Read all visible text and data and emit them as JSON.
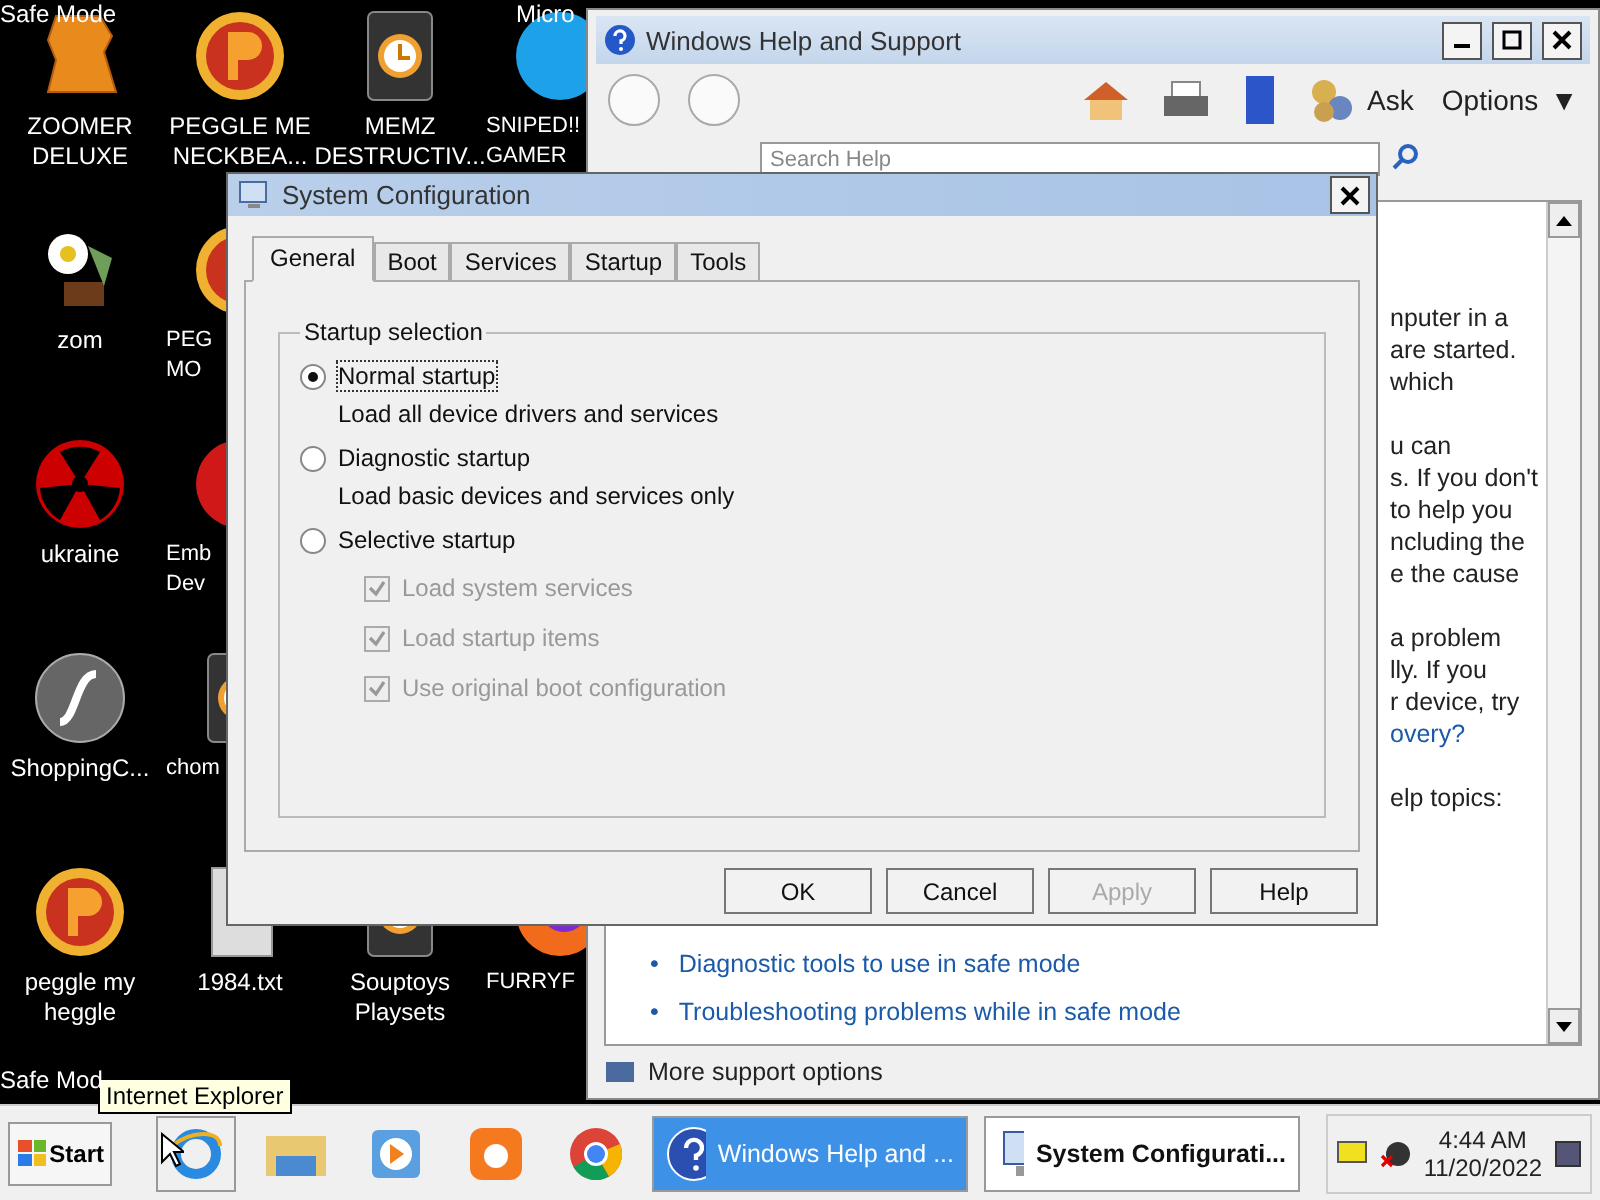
{
  "desktop": {
    "corner_texts": [
      "Safe Mode",
      "Micro",
      "Safe Mod"
    ],
    "columns": [
      [
        {
          "lines": [
            "ZOOMER",
            "DELUXE"
          ],
          "kind": "block",
          "cut": false
        },
        {
          "lines": [
            "zom"
          ],
          "kind": "flower",
          "cut": false
        },
        {
          "lines": [
            "ukraine"
          ],
          "kind": "radiation",
          "cut": false
        },
        {
          "lines": [
            "ShoppingC..."
          ],
          "kind": "flash",
          "cut": false
        },
        {
          "lines": [
            "peggle my",
            "heggle"
          ],
          "kind": "badge",
          "cut": false
        }
      ],
      [
        {
          "lines": [
            "PEGGLE ME",
            "NECKBEA..."
          ],
          "kind": "badge",
          "cut": false
        },
        {
          "lines": [
            "PEG",
            "MO"
          ],
          "kind": "badge",
          "cut": true
        },
        {
          "lines": [
            "Emb",
            "Dev"
          ],
          "kind": "red",
          "cut": true
        },
        {
          "lines": [
            "chom"
          ],
          "kind": "clock",
          "cut": true
        },
        {
          "lines": [
            "1984.txt"
          ],
          "kind": "doc",
          "cut": false
        }
      ],
      [
        {
          "lines": [
            "MEMZ",
            "DESTRUCTIV..."
          ],
          "kind": "clock",
          "cut": false
        },
        {
          "lines": [
            "Souptoys",
            "Playsets"
          ],
          "kind": "clock",
          "cut": false
        }
      ],
      [
        {
          "lines": [
            "SNIPED!!",
            "GAMER"
          ],
          "kind": "chat",
          "cut": true
        },
        {
          "lines": [
            "FURRYF"
          ],
          "kind": "fox",
          "cut": true
        }
      ]
    ]
  },
  "help_window": {
    "title": "Windows Help and Support",
    "toolbar": {
      "ask": "Ask",
      "options": "Options",
      "options_caret": "▼"
    },
    "search": {
      "placeholder": "Search Help"
    },
    "paragraphs": [
      [
        "nputer in a",
        "are started.",
        "which"
      ],
      [
        "u can",
        "s. If you don't",
        "to help you",
        "ncluding the",
        "e the cause"
      ],
      [
        "a problem",
        "lly. If you",
        "r device, try",
        "overy?"
      ],
      [
        "elp topics:"
      ]
    ],
    "links": [
      {
        "bullet": "•",
        "text": "Diagnostic tools to use in safe mode"
      },
      {
        "bullet": "•",
        "text": "Troubleshooting problems while in safe mode"
      }
    ],
    "footer": "More support options"
  },
  "dialog": {
    "title": "System Configuration",
    "tabs": [
      {
        "label": "General",
        "selected": true
      },
      {
        "label": "Boot",
        "selected": false
      },
      {
        "label": "Services",
        "selected": false
      },
      {
        "label": "Startup",
        "selected": false
      },
      {
        "label": "Tools",
        "selected": false
      }
    ],
    "group": "Startup selection",
    "options": [
      {
        "label": "Normal startup",
        "description": "Load all device drivers and services",
        "selected": true
      },
      {
        "label": "Diagnostic startup",
        "description": "Load basic devices and services only",
        "selected": false
      },
      {
        "label": "Selective startup",
        "selected": false,
        "checks": [
          {
            "label": "Load system services",
            "checked": true,
            "disabled": true
          },
          {
            "label": "Load startup items",
            "checked": true,
            "disabled": true
          },
          {
            "label": "Use original boot configuration",
            "checked": true,
            "disabled": true
          }
        ]
      }
    ],
    "buttons": [
      {
        "label": "OK",
        "disabled": false
      },
      {
        "label": "Cancel",
        "disabled": false
      },
      {
        "label": "Apply",
        "disabled": true
      },
      {
        "label": "Help",
        "disabled": false
      }
    ]
  },
  "taskbar": {
    "start": "Start",
    "tooltip": "Internet Explorer",
    "tasks": [
      {
        "label": "Windows Help and ...",
        "kind": "help",
        "selected": true
      },
      {
        "label": "System Configurati...",
        "kind": "config",
        "selected": false
      }
    ],
    "clock": {
      "time": "4:44 AM",
      "date": "11/20/2022"
    }
  }
}
